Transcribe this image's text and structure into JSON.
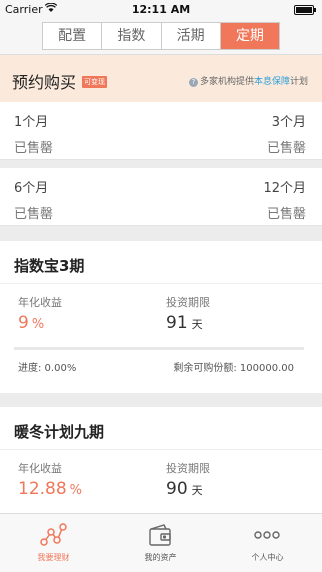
{
  "status_bar": {
    "carrier": "Carrier",
    "time": "12:11 AM"
  },
  "segmented_tabs": [
    {
      "label": "配置",
      "active": false
    },
    {
      "label": "指数",
      "active": false
    },
    {
      "label": "活期",
      "active": false
    },
    {
      "label": "定期",
      "active": true
    }
  ],
  "reserve": {
    "title": "预约购买",
    "badge": "可变现",
    "info_prefix": "多家机构提供",
    "info_highlight": "本息保障",
    "info_suffix": "计划",
    "periods": [
      {
        "left_term": "1个月",
        "left_status": "已售罄",
        "right_term": "3个月",
        "right_status": "已售罄"
      },
      {
        "left_term": "6个月",
        "left_status": "已售罄",
        "right_term": "12个月",
        "right_status": "已售罄"
      }
    ]
  },
  "products": [
    {
      "title": "指数宝3期",
      "rate_label": "年化收益",
      "rate_value": "9",
      "rate_unit": "%",
      "term_label": "投资期限",
      "term_value": "91",
      "term_unit": "天",
      "progress_text": "进度: 0.00%",
      "progress_fraction": 0.0,
      "remaining_text": "剩余可购份额: 100000.00"
    },
    {
      "title": "暖冬计划九期",
      "rate_label": "年化收益",
      "rate_value": "12.88",
      "rate_unit": "%",
      "term_label": "投资期限",
      "term_value": "90",
      "term_unit": "天"
    }
  ],
  "bottom_tabs": [
    {
      "label": "我要理财",
      "icon": "finance-network-icon",
      "active": true
    },
    {
      "label": "我的资产",
      "icon": "wallet-icon",
      "active": false
    },
    {
      "label": "个人中心",
      "icon": "more-dots-icon",
      "active": false
    }
  ],
  "colors": {
    "accent": "#f0775a",
    "link": "#2f9fd8",
    "reserve_bg": "#fbeadc"
  }
}
